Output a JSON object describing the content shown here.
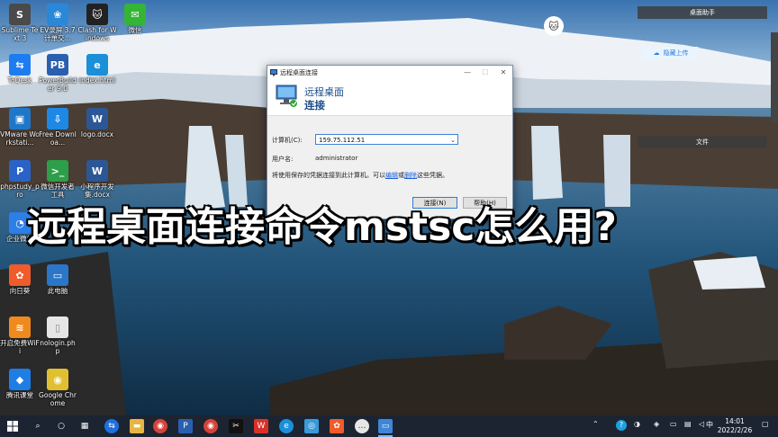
{
  "desktop_icons": [
    {
      "id": "sublime",
      "label": "Sublime Text 3",
      "color": "#4a4a4a",
      "glyph": "S"
    },
    {
      "id": "ev",
      "label": "EV录屏 3.7计单交...",
      "color": "#2b88d8",
      "glyph": "❀"
    },
    {
      "id": "clash",
      "label": "Clash for Windows",
      "color": "#222222",
      "glyph": "🐱"
    },
    {
      "id": "wechat",
      "label": "微信",
      "color": "#35b535",
      "glyph": "✉"
    },
    {
      "id": "todesk",
      "label": "ToDesk",
      "color": "#1e7cf2",
      "glyph": "⇆"
    },
    {
      "id": "powerbuilder",
      "label": "PowerBuilder 9.0",
      "color": "#2a5fb0",
      "glyph": "PB"
    },
    {
      "id": "index",
      "label": "index.html",
      "color": "#1b8fd8",
      "glyph": "e"
    },
    {
      "id": "vmware",
      "label": "VMware Workstati...",
      "color": "#1f77c9",
      "glyph": "▣"
    },
    {
      "id": "freedownload",
      "label": "Free Downloa...",
      "color": "#1e88e5",
      "glyph": "⇩"
    },
    {
      "id": "logo",
      "label": "logo.docx",
      "color": "#2b5797",
      "glyph": "W"
    },
    {
      "id": "phpstudy",
      "label": "phpstudy_pro",
      "color": "#2a63c8",
      "glyph": "P"
    },
    {
      "id": "weixindev",
      "label": "微信开发者工具",
      "color": "#2e9e4a",
      "glyph": ">_"
    },
    {
      "id": "xiaochengxu",
      "label": "小程序开发集.docx",
      "color": "#2b5797",
      "glyph": "W"
    },
    {
      "id": "qiyeweixin",
      "label": "企业微信",
      "color": "#2d7ee6",
      "glyph": "◔"
    },
    {
      "id": "xiangrikui",
      "label": "向日葵",
      "color": "#ef5b2a",
      "glyph": "✿"
    },
    {
      "id": "thispc",
      "label": "此电脑",
      "color": "#2a76c8",
      "glyph": "▭"
    },
    {
      "id": "wifi",
      "label": "开启免费WiFi",
      "color": "#f08a1c",
      "glyph": "≋"
    },
    {
      "id": "nologin",
      "label": "nologin.php",
      "color": "#e6e6e6",
      "glyph": "▯"
    },
    {
      "id": "tencentclass",
      "label": "腾讯课堂",
      "color": "#1e7ee6",
      "glyph": "◆"
    },
    {
      "id": "chrome",
      "label": "Google Chrome",
      "color": "#e0c030",
      "glyph": "◉"
    }
  ],
  "right_panel": {
    "top_title": "桌面助手",
    "cloud_button": "隐藏上传",
    "files_title": "文件"
  },
  "dialog": {
    "window_title": "远程桌面连接",
    "header_line1": "远程桌面",
    "header_line2": "连接",
    "computer_label": "计算机(C):",
    "computer_value": "159.75.112.51",
    "username_label": "用户名:",
    "username_value": "administrator",
    "cred_text_before": "将使用保存的凭据连接到此计算机。可以",
    "edit_link": "编辑",
    "or_text": "或",
    "delete_link": "删除",
    "cred_text_after": "这些凭据。",
    "connect_button": "连接(N)",
    "help_button": "帮助(H)"
  },
  "caption": "远程桌面连接命令mstsc怎么用?",
  "taskbar": {
    "ime": "中",
    "time": "14:01",
    "date": "2022/2/26"
  }
}
